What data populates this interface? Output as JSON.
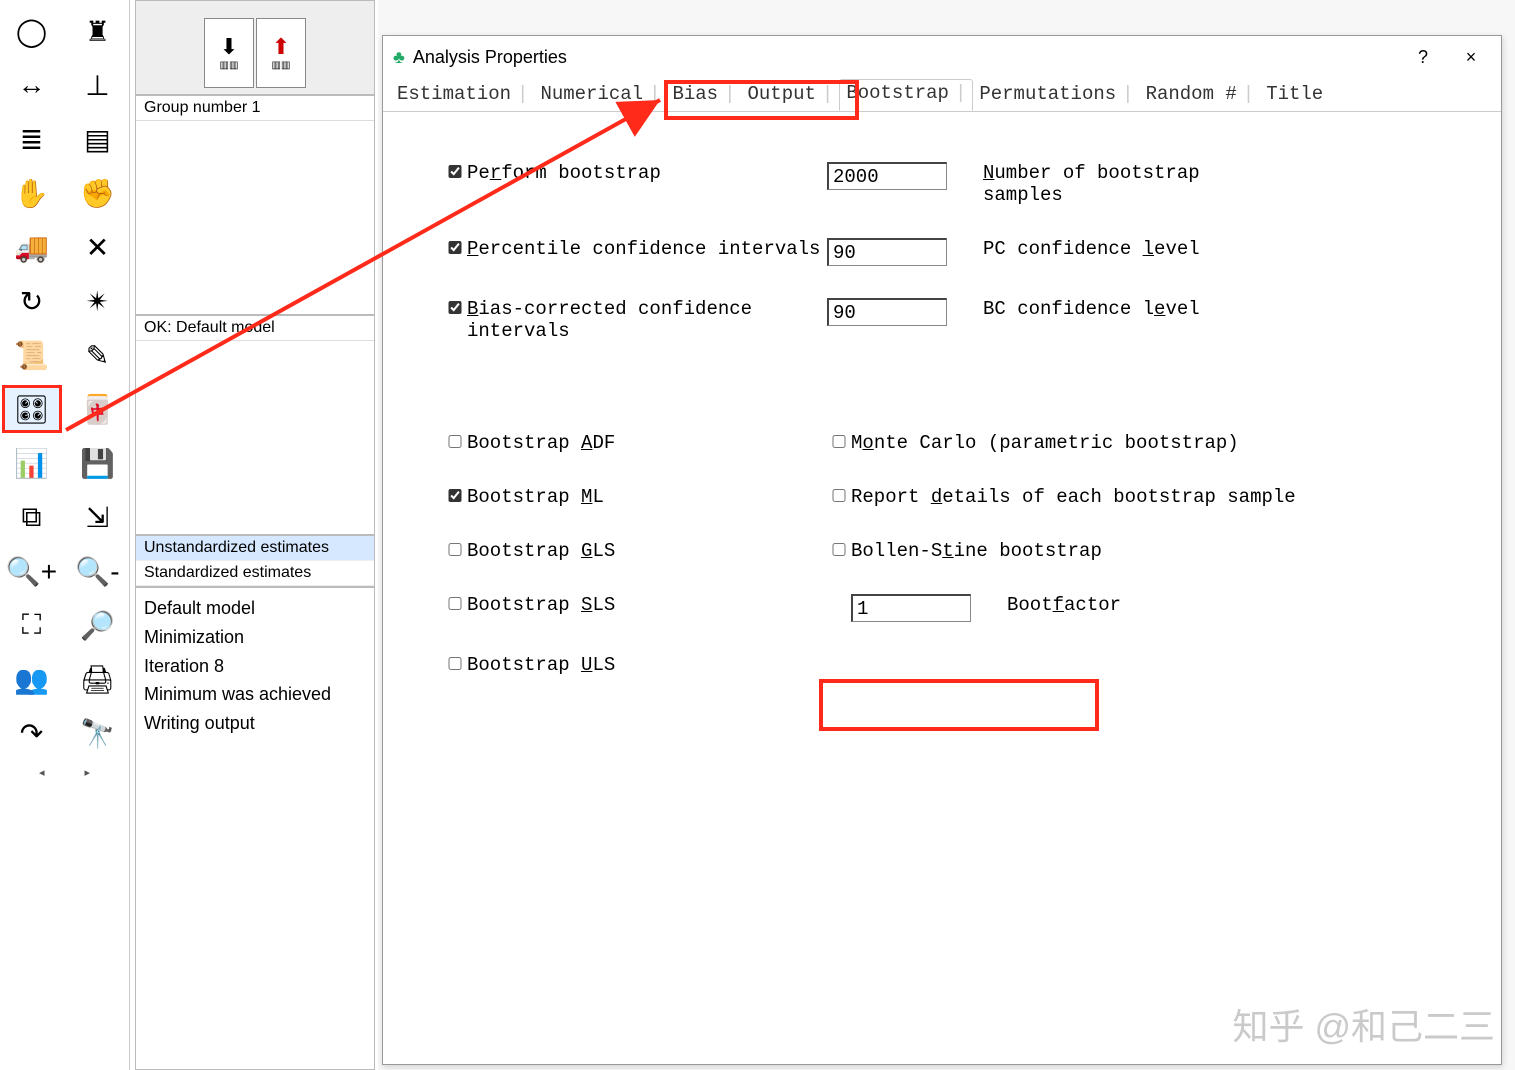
{
  "dialog": {
    "title": "Analysis Properties",
    "help": "?",
    "close": "×",
    "tabs": [
      "Estimation",
      "Numerical",
      "Bias",
      "Output",
      "Bootstrap",
      "Permutations",
      "Random #",
      "Title"
    ],
    "active_tab_index": 4,
    "fields": {
      "perform_bootstrap": {
        "checked": true,
        "label": "Perform bootstrap",
        "value": "2000",
        "rlabel": "Number of bootstrap samples"
      },
      "percentile_ci": {
        "checked": true,
        "label": "Percentile confidence intervals",
        "value": "90",
        "rlabel": "PC confidence level"
      },
      "bias_corrected_ci": {
        "checked": true,
        "label": "Bias-corrected confidence intervals",
        "value": "90",
        "rlabel": "BC confidence level"
      },
      "boot_adf": {
        "checked": false,
        "label": "Bootstrap ADF"
      },
      "boot_ml": {
        "checked": true,
        "label": "Bootstrap ML"
      },
      "boot_gls": {
        "checked": false,
        "label": "Bootstrap GLS"
      },
      "boot_sls": {
        "checked": false,
        "label": "Bootstrap SLS"
      },
      "boot_uls": {
        "checked": false,
        "label": "Bootstrap ULS"
      },
      "monte_carlo": {
        "checked": false,
        "label": "Monte Carlo (parametric bootstrap)"
      },
      "report_details": {
        "checked": false,
        "label": "Report details of each bootstrap sample"
      },
      "bollen_stine": {
        "checked": false,
        "label": "Bollen-Stine bootstrap"
      },
      "bootfactor": {
        "value": "1",
        "rlabel": "Bootfactor"
      }
    }
  },
  "leftpanels": {
    "group": "Group number 1",
    "model_status": "OK: Default model",
    "estimates": [
      "Unstandardized estimates",
      "Standardized estimates"
    ],
    "log": [
      "Default model",
      "Minimization",
      "   Iteration 8",
      "Minimum was achieved",
      "Writing output"
    ]
  },
  "toolbar": {
    "icons": [
      "ellipse",
      "indicator",
      "double-arrow",
      "error-term",
      "title-block",
      "list-block",
      "hand-select",
      "hand-move",
      "truck",
      "cross",
      "rotate",
      "color-diagram",
      "scroll",
      "pen",
      "analysis-properties",
      "abacus",
      "spreadsheet",
      "save",
      "copy-diagram",
      "copy-path",
      "zoom-in",
      "zoom-out",
      "fit-page",
      "zoom-locate",
      "copy-groups",
      "print",
      "redo",
      "binoculars"
    ],
    "selected_index": 14,
    "chev_left": "◂",
    "chev_right": "▸"
  },
  "watermark": "知乎 @和己二三"
}
